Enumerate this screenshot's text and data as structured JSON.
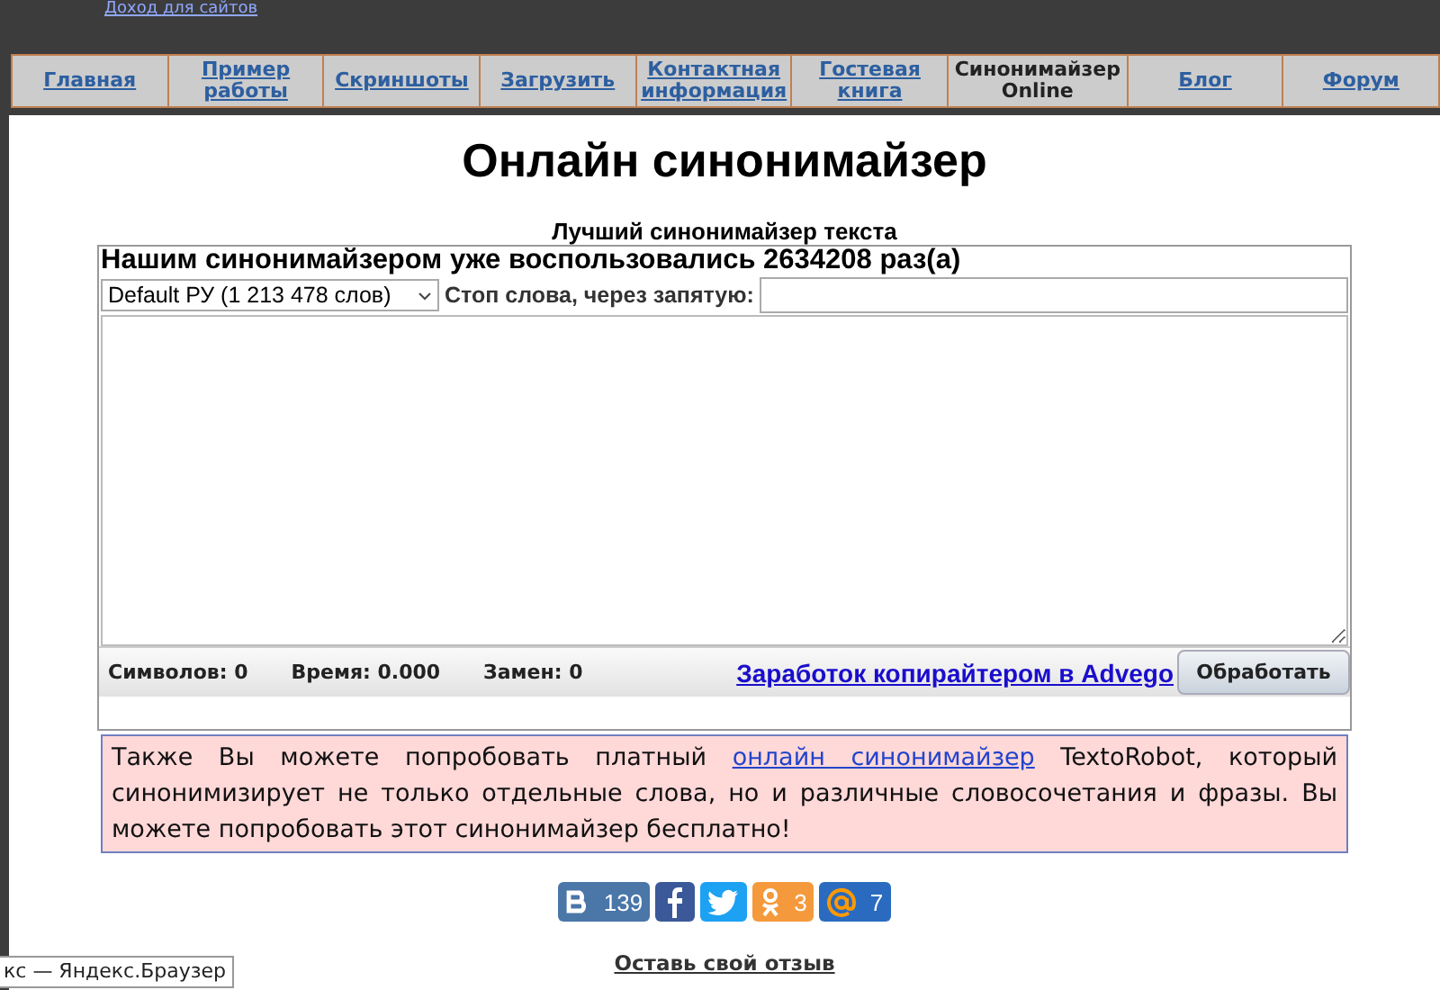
{
  "top_link": "Доход для сайтов",
  "nav": [
    {
      "label": "Главная",
      "selected": false
    },
    {
      "label": "Пример работы",
      "selected": false
    },
    {
      "label": "Скриншоты",
      "selected": false
    },
    {
      "label": "Загрузить",
      "selected": false
    },
    {
      "label": "Контактная информация",
      "selected": false
    },
    {
      "label": "Гостевая книга",
      "selected": false
    },
    {
      "label": "Синонимайзер Online",
      "selected": true
    },
    {
      "label": "Блог",
      "selected": false
    },
    {
      "label": "Форум",
      "selected": false
    }
  ],
  "title": "Онлайн синонимайзер",
  "subtitle": "Лучший синонимайзер текста",
  "usage_line": "Нашим синонимайзером уже воспользовались 2634208 раз(а)",
  "dictionary_select": "Default РУ (1 213 478 слов)",
  "stop_words_label": "Стоп слова, через запятую:",
  "stats": [
    {
      "label": "Символов:",
      "value": "0"
    },
    {
      "label": "Время:",
      "value": "0.000"
    },
    {
      "label": "Замен:",
      "value": "0"
    }
  ],
  "advego_link": "Заработок копирайтером в Advego",
  "process_button": "Обработать",
  "info": {
    "before": "Также Вы можете попробовать платный",
    "link": "онлайн синонимайзер",
    "after": "TextoRobot, который синонимизирует не только отдельные слова, но и различные словосочетания и фразы. Вы можете попробовать этот синонимайзер бесплатно!"
  },
  "share": [
    {
      "kind": "vk",
      "count": "139"
    },
    {
      "kind": "facebook"
    },
    {
      "kind": "twitter"
    },
    {
      "kind": "odnoklassniki",
      "count": "3"
    },
    {
      "kind": "mail",
      "count": "7"
    }
  ],
  "review_link": "Оставь свой отзыв",
  "tooltip": "кс — Яндекс.Браузер"
}
